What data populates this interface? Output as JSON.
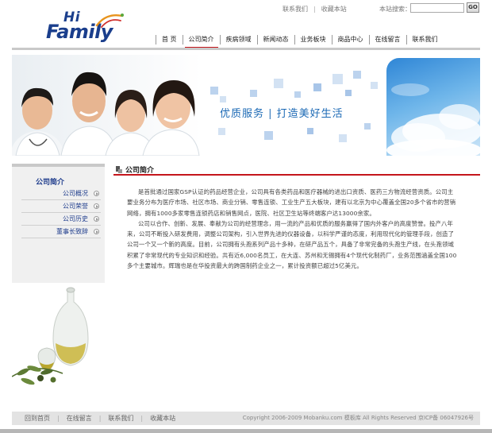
{
  "header": {
    "top_links": [
      "联系我们",
      "收藏本站"
    ],
    "search_label": "本站搜索：",
    "search_value": "",
    "search_button": "GO"
  },
  "logo": {
    "line1": "Hi",
    "line2": "Family"
  },
  "nav": {
    "items": [
      "首 页",
      "公司简介",
      "疾病领域",
      "新闻动态",
      "业务板块",
      "商品中心",
      "在线留言",
      "联系我们"
    ],
    "active_index": 1
  },
  "banner": {
    "slogan": "优质服务 | 打造美好生活"
  },
  "sidebar": {
    "title": "公司简介",
    "items": [
      "公司概况",
      "公司荣誉",
      "公司历史",
      "董事长致辞"
    ]
  },
  "content": {
    "title": "公司简介",
    "paragraphs": [
      "是首批通过国家GSP认证的药品经营企业，公司具有各类药品和医疗器械的进出口资质、医药三方物流经营资质。公司主要业务分布为医疗市场、社区市场、商业分销、零售连锁、工业生产五大板块，建有以北京为中心覆盖全国20多个省市的营销网络，拥有1000多家零售连锁药店和销售网点，医院、社区卫生站等终端客户达13000余家。",
      "公司以合作、创新、发展、奉献为公司的经营理念，用一流的产品和优质的服务赢得了国内外客户的高度赞誉。投产八年来，公司不断投入研发费用，调整公司架构，引入世界先进的仪器设备，以科学严谨的态度，利用现代化的管理手段，创造了公司一个又一个新的高度。目前，公司拥有头孢系列产品十多种，在研产品五个，具备了非常完备的头孢生产线，在头孢领域积累了非常现代的专业知识和经验。共有近6,000名员工，在大连、苏州和无锡拥有4个现代化制药厂，业务范围涵盖全国100多个主要城市。辉瑞也是在华投资最大的跨国制药企业之一，累计投资额已超过5亿美元。"
    ]
  },
  "footer": {
    "links": [
      "回到首页",
      "在线留言",
      "联系我们",
      "收藏本站"
    ],
    "copyright": "Copyright 2006-2009 Mobanku.com 模板库  All Rights Reserved 京ICP备 06047926号"
  }
}
